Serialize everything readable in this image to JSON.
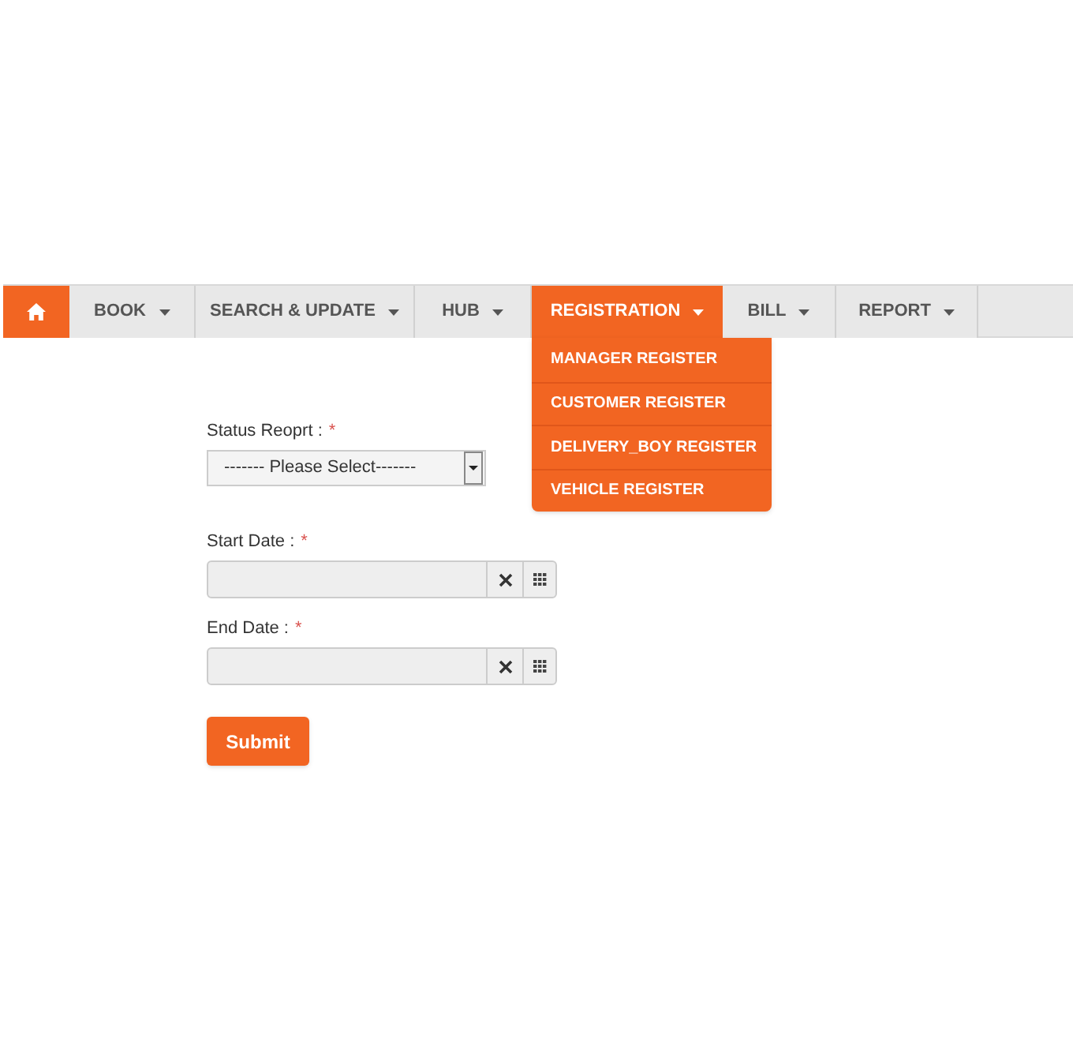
{
  "nav": {
    "items": [
      {
        "kind": "home",
        "selected": false
      },
      {
        "kind": "menu",
        "label": "BOOK",
        "selected": false
      },
      {
        "kind": "menu",
        "label": "SEARCH & UPDATE",
        "selected": false
      },
      {
        "kind": "menu",
        "label": "HUB",
        "selected": false
      },
      {
        "kind": "menu",
        "label": "REGISTRATION",
        "selected": true,
        "expanded": true,
        "submenu": [
          "MANAGER REGISTER",
          "CUSTOMER REGISTER",
          "DELIVERY_BOY REGISTER",
          "VEHICLE REGISTER"
        ]
      },
      {
        "kind": "menu",
        "label": "BILL",
        "selected": false
      },
      {
        "kind": "menu",
        "label": "REPORT",
        "selected": false
      }
    ]
  },
  "form": {
    "fields": [
      {
        "kind": "select",
        "label": "Status Reoprt :",
        "required_mark": "*",
        "value": "------- Please Select-------"
      },
      {
        "kind": "date",
        "label": "Start Date :",
        "required_mark": "*"
      },
      {
        "kind": "date",
        "label": "End Date :",
        "required_mark": "*"
      }
    ],
    "submit": "Submit"
  }
}
